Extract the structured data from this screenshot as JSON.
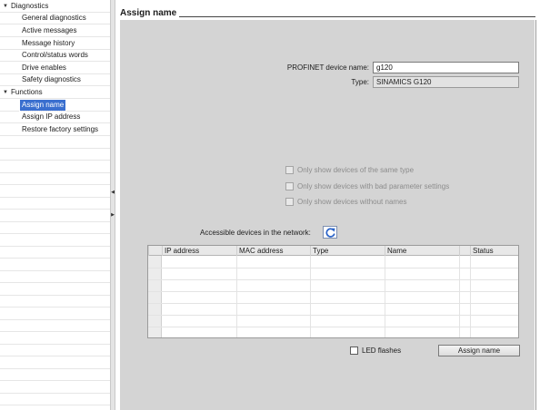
{
  "tree": {
    "diagnostics_group": "Diagnostics",
    "diagnostics_items": [
      "General diagnostics",
      "Active messages",
      "Message history",
      "Control/status words",
      "Drive enables",
      "Safety diagnostics"
    ],
    "functions_group": "Functions",
    "functions_items": [
      "Assign name",
      "Assign IP address",
      "Restore factory settings"
    ],
    "selected_item": "Assign name",
    "expand_icon": "triangle-down-icon"
  },
  "panel": {
    "title": "Assign name",
    "profinet_label": "PROFINET device name:",
    "profinet_value": "g120",
    "type_label": "Type:",
    "type_value": "SINAMICS G120",
    "filters": [
      "Only show devices of the same type",
      "Only show devices with bad parameter settings",
      "Only show devices without names"
    ],
    "accessible_label": "Accessible devices in the network:",
    "refresh_icon": "refresh-icon",
    "table": {
      "columns": [
        "IP address",
        "MAC address",
        "Type",
        "Name",
        "Status"
      ],
      "rows": []
    },
    "led_label": "LED flashes",
    "assign_button": "Assign name"
  },
  "colors": {
    "panel_bg": "#d4d4d4",
    "selection": "#3a6fcf",
    "refresh_blue": "#2a63c8"
  }
}
